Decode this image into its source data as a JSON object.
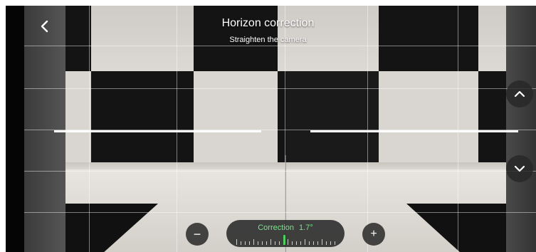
{
  "header": {
    "title": "Horizon correction",
    "subtitle": "Straighten the camera"
  },
  "controls": {
    "back_icon": "chevron-left-icon",
    "up_icon": "chevron-up-icon",
    "down_icon": "chevron-down-icon",
    "minus_label": "−",
    "plus_label": "+"
  },
  "correction": {
    "label": "Correction",
    "value": "1.7°"
  },
  "colors": {
    "accent": "#4bd25e",
    "label_green": "#7be08a"
  }
}
